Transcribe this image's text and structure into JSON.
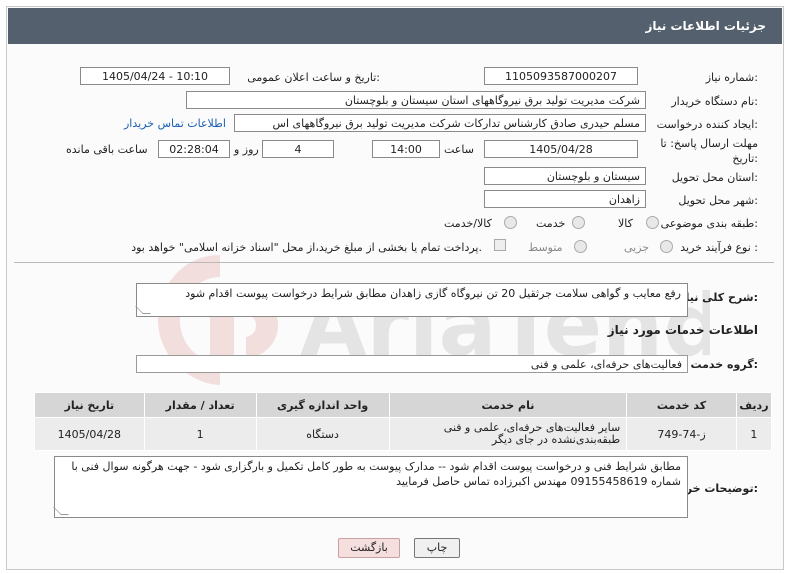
{
  "header": {
    "title": "جزئیات اطلاعات نیاز"
  },
  "form": {
    "need_number_label": "شماره نیاز:",
    "need_number": "1105093587000207",
    "announce_label": "تاریخ و ساعت اعلان عمومی:",
    "announce_value": "1405/04/24 - 10:10",
    "buyer_org_label": "نام دستگاه خریدار:",
    "buyer_org": "شرکت مدیریت تولید برق نیروگاههای استان سیستان و بلوچستان",
    "creator_label": "ایجاد کننده درخواست:",
    "creator": "مسلم حیدری صادق کارشناس تدارکات شرکت مدیریت تولید برق نیروگاههای اس",
    "contact_link": "اطلاعات تماس خریدار",
    "deadline_label_1": "مهلت ارسال پاسخ: تا",
    "deadline_label_2": "تاریخ:",
    "deadline_date": "1405/04/28",
    "time_label": "ساعت",
    "deadline_time": "14:00",
    "days_value": "4",
    "days_label": "روز و",
    "remaining_time": "02:28:04",
    "remaining_label": "ساعت باقی مانده",
    "province_label": "استان محل تحویل:",
    "province": "سیستان و بلوچستان",
    "city_label": "شهر محل تحویل:",
    "city": "زاهدان",
    "category_label": "طبقه بندی موضوعی:",
    "category_options": [
      "کالا",
      "خدمت",
      "کالا/خدمت"
    ],
    "purchase_label": "نوع فرآیند خرید :",
    "purchase_options": [
      "جزیی",
      "متوسط"
    ],
    "payment_note": "پرداخت تمام یا بخشی از مبلغ خرید،از محل \"اسناد خزانه اسلامی\" خواهد بود."
  },
  "summary": {
    "label": "شرح کلی نیاز:",
    "text": "رفع معایب و گواهی سلامت  جرثقیل 20 تن نیروگاه گازی زاهدان مطابق شرایط درخواست پیوست اقدام شود"
  },
  "services": {
    "section_title": "اطلاعات خدمات مورد نیاز",
    "group_label": "گروه خدمت:",
    "group_value": "فعالیت‌های حرفه‌ای، علمی و فنی",
    "columns": [
      "ردیف",
      "کد خدمت",
      "نام خدمت",
      "واحد اندازه گیری",
      "تعداد / مقدار",
      "تاریخ نیاز"
    ],
    "rows": [
      [
        "1",
        "ز-74-749",
        "سایر فعالیت‌های حرفه‌ای، علمی و فنی طبقه‌بندی‌نشده در جای دیگر",
        "دستگاه",
        "1",
        "1405/04/28"
      ]
    ]
  },
  "buyer_notes": {
    "label": "توضیحات خریدار:",
    "text": "مطابق شرایط فنی و درخواست  پیوست اقدام شود  -- مدارک پیوست به طور کامل تکمیل و بارگزاری شود - جهت هرگونه سوال فنی با شماره 09155458619 مهندس اکبرزاده تماس حاصل فرمایید"
  },
  "buttons": {
    "print": "چاپ",
    "back": "بازگشت"
  },
  "colors": {
    "titlebar": "#55606f",
    "link": "#1a5fb4",
    "back_button": "#f5dede",
    "watermark": "#c62828"
  }
}
